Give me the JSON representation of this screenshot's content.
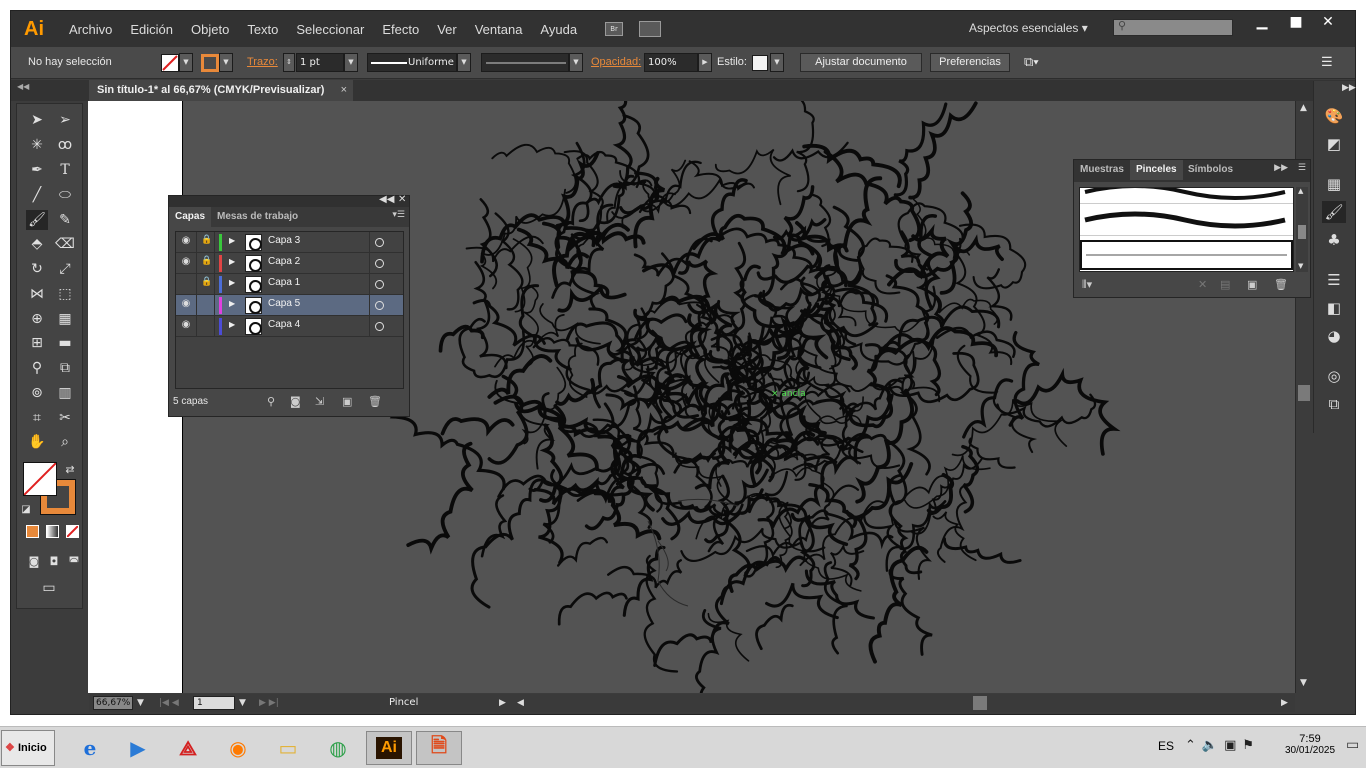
{
  "app": {
    "logo": "Ai"
  },
  "menu": [
    "Archivo",
    "Edición",
    "Objeto",
    "Texto",
    "Seleccionar",
    "Efecto",
    "Ver",
    "Ventana",
    "Ayuda"
  ],
  "menu_icons": {
    "bridge": "Br",
    "arrange": "arrange-documents-icon"
  },
  "workspace": {
    "label": "Aspectos esenciales",
    "search_placeholder": ""
  },
  "window_controls": {
    "minimize": "▁",
    "maximize": "■",
    "close": "✕"
  },
  "control_bar": {
    "selection": "No hay selección",
    "stroke_label": "Trazo:",
    "stroke_weight": "1 pt",
    "profile": "Uniforme",
    "opacity_label": "Opacidad:",
    "opacity_value": "100%",
    "style_label": "Estilo:",
    "fit_button": "Ajustar documento",
    "prefs_button": "Preferencias",
    "fill_color": "#ffffff",
    "stroke_color": "#e8893a"
  },
  "document": {
    "tab_title": "Sin título-1* al 66,67% (CMYK/Previsualizar)",
    "close": "×"
  },
  "canvas": {
    "anchor_label": "ancla",
    "artwork": "curly-hair-line-drawing"
  },
  "status_bar": {
    "zoom": "66,67%",
    "page": "1",
    "current_tool": "Pincel"
  },
  "layers_panel": {
    "tabs": [
      "Capas",
      "Mesas de trabajo"
    ],
    "count_label": "5 capas",
    "layers": [
      {
        "name": "Capa 3",
        "color": "#39c83c",
        "visible": true,
        "locked": true,
        "selected": false
      },
      {
        "name": "Capa 2",
        "color": "#e04545",
        "visible": true,
        "locked": true,
        "selected": false
      },
      {
        "name": "Capa 1",
        "color": "#4c6dd6",
        "visible": false,
        "locked": true,
        "selected": false
      },
      {
        "name": "Capa 5",
        "color": "#e040e0",
        "visible": true,
        "locked": false,
        "selected": true
      },
      {
        "name": "Capa 4",
        "color": "#4c4cd6",
        "visible": true,
        "locked": false,
        "selected": false
      }
    ]
  },
  "brushes_panel": {
    "tabs": [
      "Muestras",
      "Pinceles",
      "Símbolos"
    ],
    "active_tab": "Pinceles"
  },
  "taskbar": {
    "start": "Inicio",
    "apps": [
      "internet-explorer-icon",
      "media-player-icon",
      "acrobat-icon",
      "firefox-icon",
      "file-explorer-icon",
      "chrome-icon",
      "illustrator-icon",
      "document-icon"
    ],
    "illustrator_label": "Ai",
    "language": "ES",
    "time": "7:59",
    "date": "30/01/2025"
  }
}
